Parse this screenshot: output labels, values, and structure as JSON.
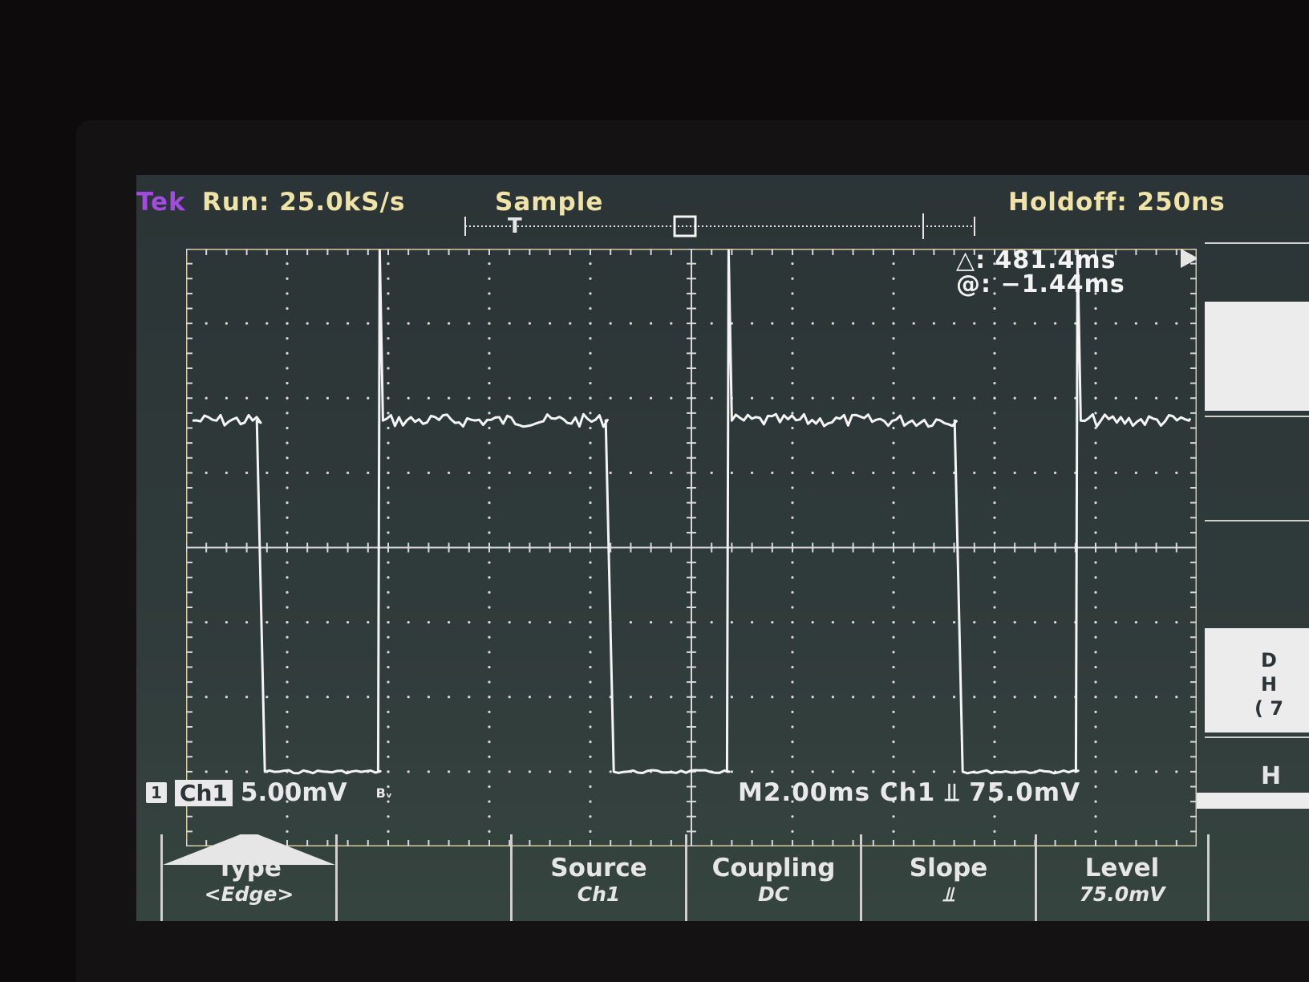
{
  "header": {
    "brand": "Tek",
    "run_status": "Run: 25.0kS/s",
    "acq_mode": "Sample",
    "holdoff": "Holdoff: 250ns"
  },
  "measurement": {
    "delta": "△: 481.4ms",
    "at": "@: −1.44ms"
  },
  "channel": {
    "marker": "1",
    "name": "Ch1",
    "scale": "5.00mV",
    "bw": "Bᵥ"
  },
  "timebase": {
    "text": "M2.00ms  Ch1 ⫫  75.0mV"
  },
  "menu": [
    {
      "label": "Type",
      "value": "<Edge>"
    },
    {
      "label": "",
      "value": ""
    },
    {
      "label": "Source",
      "value": "Ch1"
    },
    {
      "label": "Coupling",
      "value": "DC"
    },
    {
      "label": "Slope",
      "value": "⫫"
    },
    {
      "label": "Level",
      "value": "75.0mV"
    }
  ],
  "side_menu": {
    "partial_1": "D",
    "partial_2": "H",
    "partial_3": "( 7",
    "partial_4": "H"
  },
  "colors": {
    "trace": "#f4f4f4",
    "grid": "#d8d8d8",
    "header_text": "#f0e3a8",
    "brand": "#a24be0"
  },
  "waveform": {
    "period_div": 3.5,
    "high_level_div": 1.7,
    "low_level_div": -3.0
  }
}
